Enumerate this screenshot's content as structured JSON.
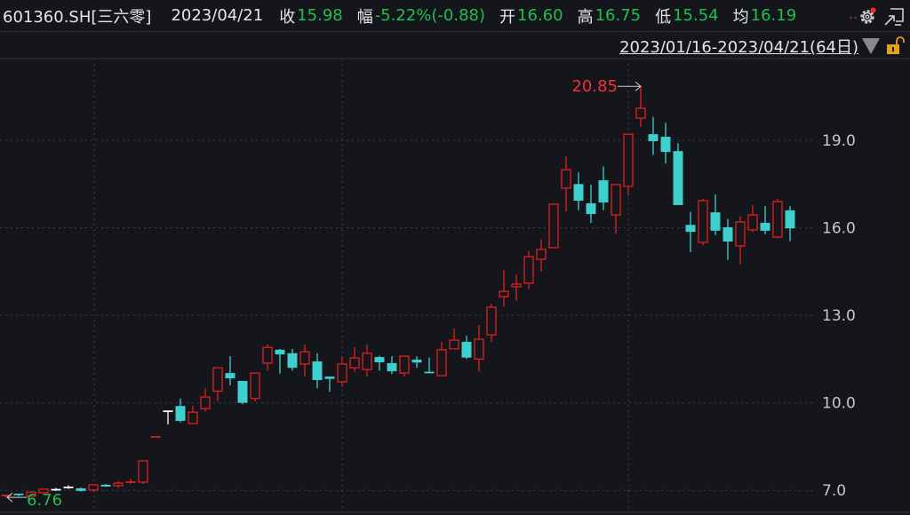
{
  "header": {
    "symbol": "601360.SH[三六零]",
    "date": "2023/04/21",
    "close_label": "收",
    "close": "15.98",
    "change_label": "幅",
    "change": "-5.22%(-0.88)",
    "open_label": "开",
    "open": "16.60",
    "high_label": "高",
    "high": "16.75",
    "low_label": "低",
    "low": "15.54",
    "avg_label": "均",
    "avg": "16.19",
    "more": ".."
  },
  "range": {
    "text": "2023/01/16-2023/04/21(64日)"
  },
  "colors": {
    "up": "#e01f1f",
    "down": "#3ecfcf",
    "flat": "#ffffff",
    "text_green": "#1fbf4f",
    "text_red": "#f0303a",
    "background": "#14161b"
  },
  "chart_data": {
    "type": "candlestick",
    "title": "601360.SH 三六零",
    "xlabel": "",
    "ylabel": "",
    "date_range": "2023/01/16-2023/04/21",
    "ylim": [
      6.5,
      21.0
    ],
    "yticks": [
      "19.0",
      "16.0",
      "13.0",
      "10.0",
      "7.0"
    ],
    "grid": true,
    "annotations": {
      "max": "20.85",
      "min": "6.76"
    },
    "ohlc": [
      [
        6.8,
        6.85,
        6.76,
        6.82
      ],
      [
        6.86,
        6.88,
        6.8,
        6.82
      ],
      [
        6.8,
        6.96,
        6.78,
        6.94
      ],
      [
        6.92,
        7.06,
        6.9,
        7.04
      ],
      [
        7.02,
        7.08,
        6.98,
        7.02
      ],
      [
        7.1,
        7.17,
        7.05,
        7.1
      ],
      [
        7.07,
        7.1,
        6.95,
        6.98
      ],
      [
        7.01,
        7.2,
        6.95,
        7.19
      ],
      [
        7.19,
        7.22,
        7.12,
        7.13
      ],
      [
        7.16,
        7.32,
        7.08,
        7.25
      ],
      [
        7.24,
        7.4,
        7.22,
        7.28
      ],
      [
        7.28,
        8.01,
        7.22,
        8.01
      ],
      [
        8.82,
        8.83,
        8.82,
        8.83
      ],
      [
        9.71,
        9.71,
        9.26,
        9.71
      ],
      [
        9.89,
        10.15,
        9.33,
        9.38
      ],
      [
        9.29,
        9.9,
        9.29,
        9.68
      ],
      [
        9.8,
        10.5,
        9.7,
        10.2
      ],
      [
        10.4,
        11.2,
        10.05,
        11.2
      ],
      [
        11.02,
        11.6,
        10.6,
        10.84
      ],
      [
        10.75,
        10.75,
        9.95,
        10.0
      ],
      [
        10.15,
        11.02,
        10.05,
        11.02
      ],
      [
        11.36,
        12.0,
        11.1,
        11.9
      ],
      [
        11.82,
        11.85,
        11.0,
        11.66
      ],
      [
        11.7,
        11.85,
        11.1,
        11.2
      ],
      [
        11.33,
        12.0,
        10.9,
        11.75
      ],
      [
        11.42,
        11.7,
        10.5,
        10.78
      ],
      [
        10.9,
        10.9,
        10.38,
        10.82
      ],
      [
        10.72,
        11.6,
        10.55,
        11.33
      ],
      [
        11.2,
        11.9,
        11.05,
        11.54
      ],
      [
        11.14,
        12.0,
        10.9,
        11.7
      ],
      [
        11.57,
        11.62,
        11.1,
        11.39
      ],
      [
        11.36,
        11.6,
        10.98,
        11.08
      ],
      [
        11.02,
        11.6,
        10.9,
        11.6
      ],
      [
        11.48,
        11.6,
        11.2,
        11.38
      ],
      [
        11.04,
        11.55,
        11.02,
        11.02
      ],
      [
        10.93,
        12.1,
        10.93,
        11.82
      ],
      [
        11.85,
        12.55,
        11.85,
        12.15
      ],
      [
        12.09,
        12.3,
        11.5,
        11.55
      ],
      [
        11.5,
        12.67,
        11.08,
        12.18
      ],
      [
        12.33,
        13.4,
        12.1,
        13.28
      ],
      [
        13.64,
        14.56,
        13.3,
        13.82
      ],
      [
        13.98,
        14.4,
        13.5,
        14.07
      ],
      [
        14.1,
        15.2,
        13.9,
        15.01
      ],
      [
        14.92,
        15.6,
        14.5,
        15.26
      ],
      [
        15.32,
        16.81,
        15.3,
        16.81
      ],
      [
        17.36,
        18.45,
        16.56,
        17.99
      ],
      [
        17.5,
        17.9,
        16.6,
        16.93
      ],
      [
        16.84,
        17.48,
        16.17,
        16.47
      ],
      [
        17.63,
        18.1,
        16.6,
        16.87
      ],
      [
        16.44,
        17.48,
        15.8,
        17.48
      ],
      [
        17.42,
        19.21,
        17.1,
        19.21
      ],
      [
        19.76,
        20.85,
        19.45,
        20.1
      ],
      [
        19.21,
        19.8,
        18.5,
        18.97
      ],
      [
        19.12,
        19.6,
        18.2,
        18.6
      ],
      [
        18.63,
        18.9,
        16.78,
        16.78
      ],
      [
        16.1,
        16.55,
        15.16,
        15.86
      ],
      [
        15.5,
        17.0,
        15.4,
        16.93
      ],
      [
        16.53,
        17.14,
        15.75,
        15.9
      ],
      [
        16.02,
        16.3,
        14.9,
        15.53
      ],
      [
        15.38,
        16.4,
        14.74,
        16.2
      ],
      [
        15.93,
        16.77,
        15.85,
        16.44
      ],
      [
        16.17,
        16.75,
        15.78,
        15.9
      ],
      [
        15.68,
        17.0,
        15.65,
        16.9
      ],
      [
        16.6,
        16.75,
        15.54,
        15.98
      ]
    ]
  }
}
